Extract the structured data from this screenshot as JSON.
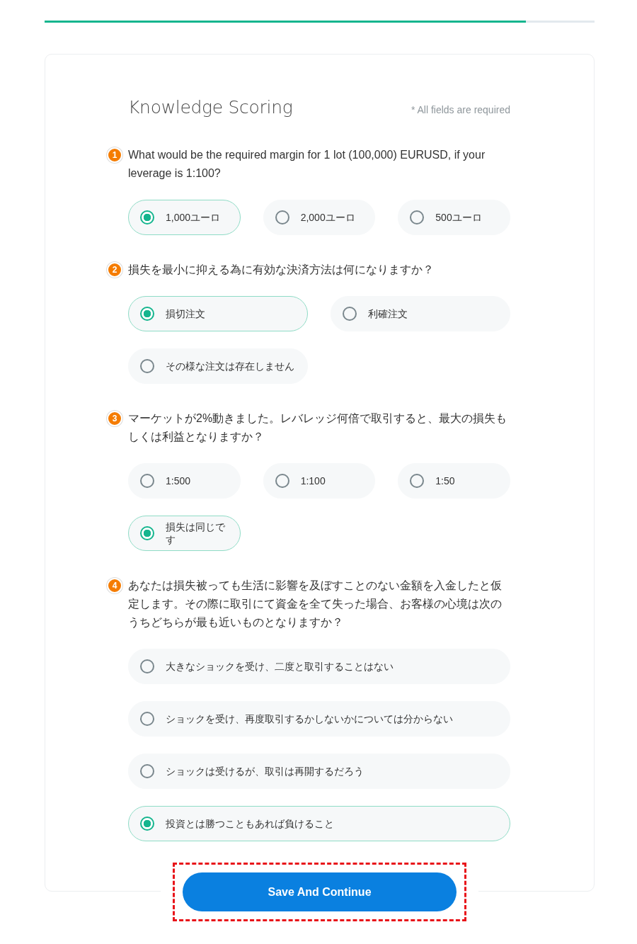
{
  "progress": {
    "level": 0.875
  },
  "form": {
    "title": "Knowledge Scoring",
    "required_note": "* All fields are required",
    "questions": [
      {
        "number": "1",
        "text": "What would be the required margin for 1 lot (100,000) EURUSD, if your leverage is 1:100?",
        "kind": "thirds",
        "options": [
          {
            "label": "1,000ユーロ",
            "selected": true
          },
          {
            "label": "2,000ユーロ",
            "selected": false
          },
          {
            "label": "500ユーロ",
            "selected": false
          }
        ]
      },
      {
        "number": "2",
        "text": "損失を最小に抑える為に有効な決済方法は何になりますか？",
        "kind": "halves",
        "options": [
          {
            "label": "損切注文",
            "selected": true
          },
          {
            "label": "利確注文",
            "selected": false
          },
          {
            "label": "その様な注文は存在しません",
            "selected": false
          }
        ]
      },
      {
        "number": "3",
        "text": "マーケットが2%動きました。レバレッジ何倍で取引すると、最大の損失もしくは利益となりますか？",
        "kind": "thirds",
        "options": [
          {
            "label": "1:500",
            "selected": false
          },
          {
            "label": "1:100",
            "selected": false
          },
          {
            "label": "1:50",
            "selected": false
          },
          {
            "label": "損失は同じです",
            "selected": true
          }
        ]
      },
      {
        "number": "4",
        "text": "あなたは損失被っても生活に影響を及ぼすことのない金額を入金したと仮定します。その際に取引にて資金を全て失った場合、お客様の心境は次のうちどちらが最も近いものとなりますか？",
        "kind": "full",
        "options": [
          {
            "label": "大きなショックを受け、二度と取引することはない",
            "selected": false
          },
          {
            "label": "ショックを受け、再度取引するかしないかについては分からない",
            "selected": false
          },
          {
            "label": "ショックは受けるが、取引は再開するだろう",
            "selected": false
          },
          {
            "label": "投資とは勝つこともあれば負けること",
            "selected": true
          }
        ]
      }
    ]
  },
  "save_button": {
    "label": "Save And Continue",
    "highlighted": true
  }
}
